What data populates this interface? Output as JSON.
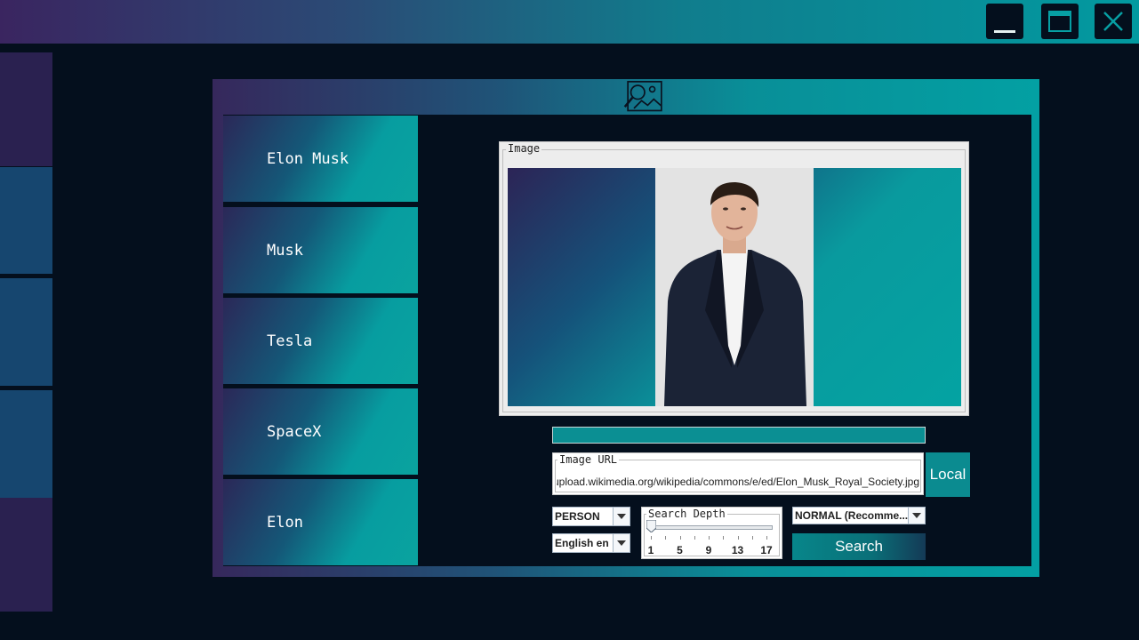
{
  "sidebar": {
    "items": [
      {
        "label": "Elon Musk"
      },
      {
        "label": "Musk"
      },
      {
        "label": "Tesla"
      },
      {
        "label": "SpaceX"
      },
      {
        "label": "Elon"
      }
    ]
  },
  "image_panel": {
    "title": "Image"
  },
  "url_field": {
    "label": "Image URL",
    "value": "https://upload.wikimedia.org/wikipedia/commons/e/ed/Elon_Musk_Royal_Society.jpg"
  },
  "local_button": {
    "label": "Local"
  },
  "entity_type": {
    "selected": "PERSON"
  },
  "language": {
    "selected": "English en"
  },
  "search_depth": {
    "label": "Search Depth",
    "value": 1,
    "min": 1,
    "max": 17,
    "tick_labels": [
      "1",
      "5",
      "9",
      "13",
      "17"
    ]
  },
  "mode": {
    "selected": "NORMAL (Recomme..."
  },
  "search_button": {
    "label": "Search"
  },
  "colors": {
    "accent": "#039fa2",
    "background": "#040f1d",
    "purple": "#36285c"
  }
}
